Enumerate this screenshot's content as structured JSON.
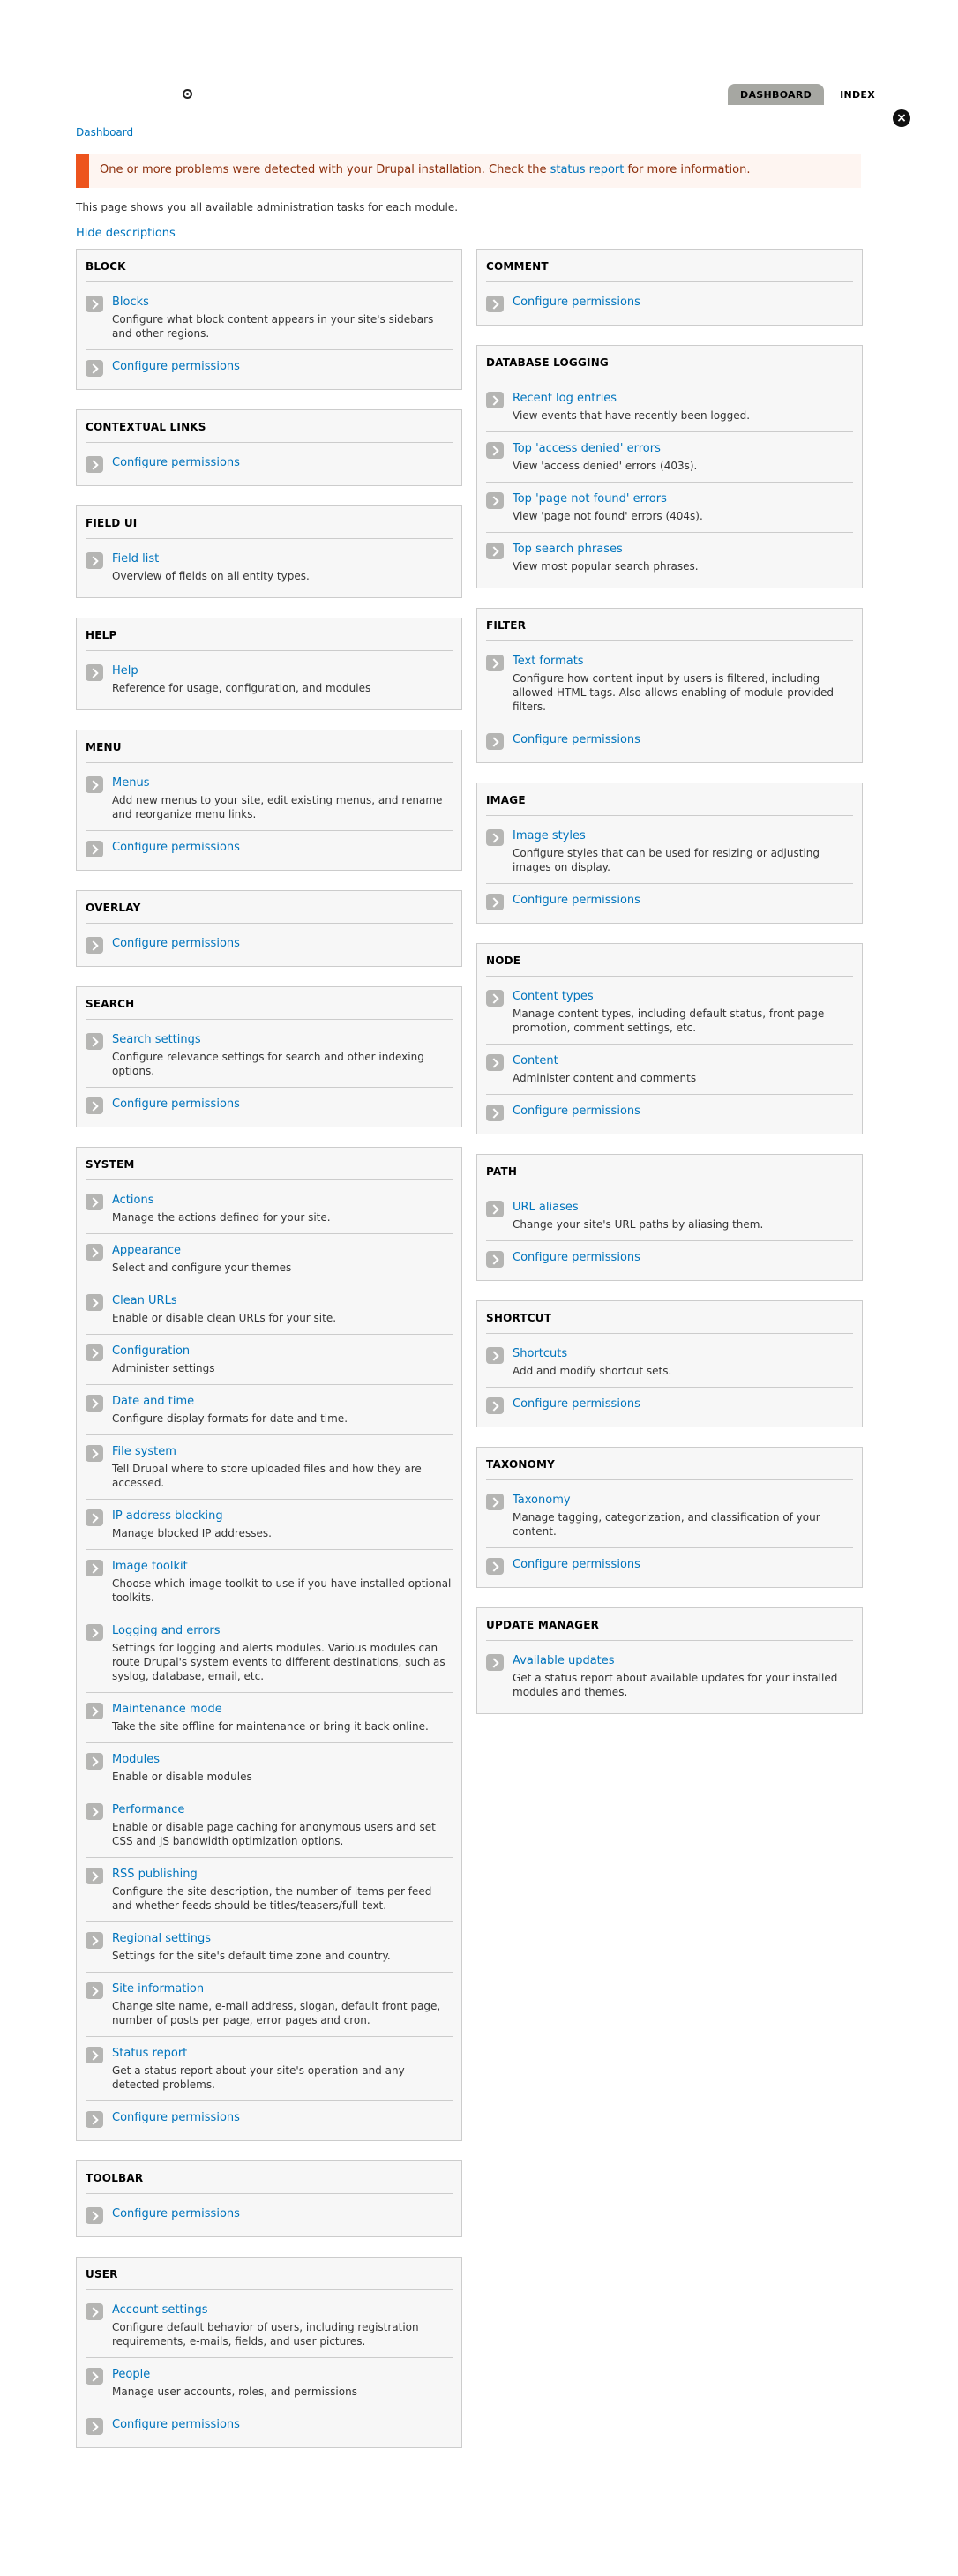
{
  "header": {
    "tabs": [
      {
        "label": "DASHBOARD",
        "active": true
      },
      {
        "label": "INDEX",
        "active": false
      }
    ],
    "close_symbol": "×"
  },
  "breadcrumb": "Dashboard",
  "message": {
    "prefix": "One or more problems were detected with your Drupal installation. Check the ",
    "link": "status report",
    "suffix": " for more information."
  },
  "intro": "This page shows you all available administration tasks for each module.",
  "hide_descriptions": "Hide descriptions",
  "left_panels": [
    {
      "title": "BLOCK",
      "items": [
        {
          "title": "Blocks",
          "desc": "Configure what block content appears in your site's sidebars and other regions."
        },
        {
          "title": "Configure permissions",
          "desc": ""
        }
      ]
    },
    {
      "title": "CONTEXTUAL LINKS",
      "items": [
        {
          "title": "Configure permissions",
          "desc": ""
        }
      ]
    },
    {
      "title": "FIELD UI",
      "items": [
        {
          "title": "Field list",
          "desc": "Overview of fields on all entity types."
        }
      ]
    },
    {
      "title": "HELP",
      "items": [
        {
          "title": "Help",
          "desc": "Reference for usage, configuration, and modules"
        }
      ]
    },
    {
      "title": "MENU",
      "items": [
        {
          "title": "Menus",
          "desc": "Add new menus to your site, edit existing menus, and rename and reorganize menu links."
        },
        {
          "title": "Configure permissions",
          "desc": ""
        }
      ]
    },
    {
      "title": "OVERLAY",
      "items": [
        {
          "title": "Configure permissions",
          "desc": ""
        }
      ]
    },
    {
      "title": "SEARCH",
      "items": [
        {
          "title": "Search settings",
          "desc": "Configure relevance settings for search and other indexing options."
        },
        {
          "title": "Configure permissions",
          "desc": ""
        }
      ]
    },
    {
      "title": "SYSTEM",
      "items": [
        {
          "title": "Actions",
          "desc": "Manage the actions defined for your site."
        },
        {
          "title": "Appearance",
          "desc": "Select and configure your themes"
        },
        {
          "title": "Clean URLs",
          "desc": "Enable or disable clean URLs for your site."
        },
        {
          "title": "Configuration",
          "desc": "Administer settings"
        },
        {
          "title": "Date and time",
          "desc": "Configure display formats for date and time."
        },
        {
          "title": "File system",
          "desc": "Tell Drupal where to store uploaded files and how they are accessed."
        },
        {
          "title": "IP address blocking",
          "desc": "Manage blocked IP addresses."
        },
        {
          "title": "Image toolkit",
          "desc": "Choose which image toolkit to use if you have installed optional toolkits."
        },
        {
          "title": "Logging and errors",
          "desc": "Settings for logging and alerts modules. Various modules can route Drupal's system events to different destinations, such as syslog, database, email, etc."
        },
        {
          "title": "Maintenance mode",
          "desc": "Take the site offline for maintenance or bring it back online."
        },
        {
          "title": "Modules",
          "desc": "Enable or disable modules"
        },
        {
          "title": "Performance",
          "desc": "Enable or disable page caching for anonymous users and set CSS and JS bandwidth optimization options."
        },
        {
          "title": "RSS publishing",
          "desc": "Configure the site description, the number of items per feed and whether feeds should be titles/teasers/full-text."
        },
        {
          "title": "Regional settings",
          "desc": "Settings for the site's default time zone and country."
        },
        {
          "title": "Site information",
          "desc": "Change site name, e-mail address, slogan, default front page, number of posts per page, error pages and cron."
        },
        {
          "title": "Status report",
          "desc": "Get a status report about your site's operation and any detected problems."
        },
        {
          "title": "Configure permissions",
          "desc": ""
        }
      ]
    },
    {
      "title": "TOOLBAR",
      "items": [
        {
          "title": "Configure permissions",
          "desc": ""
        }
      ]
    },
    {
      "title": "USER",
      "items": [
        {
          "title": "Account settings",
          "desc": "Configure default behavior of users, including registration requirements, e-mails, fields, and user pictures."
        },
        {
          "title": "People",
          "desc": "Manage user accounts, roles, and permissions"
        },
        {
          "title": "Configure permissions",
          "desc": ""
        }
      ]
    }
  ],
  "right_panels": [
    {
      "title": "COMMENT",
      "items": [
        {
          "title": "Configure permissions",
          "desc": ""
        }
      ]
    },
    {
      "title": "DATABASE LOGGING",
      "items": [
        {
          "title": "Recent log entries",
          "desc": "View events that have recently been logged."
        },
        {
          "title": "Top 'access denied' errors",
          "desc": "View 'access denied' errors (403s)."
        },
        {
          "title": "Top 'page not found' errors",
          "desc": "View 'page not found' errors (404s)."
        },
        {
          "title": "Top search phrases",
          "desc": "View most popular search phrases."
        }
      ]
    },
    {
      "title": "FILTER",
      "items": [
        {
          "title": "Text formats",
          "desc": "Configure how content input by users is filtered, including allowed HTML tags. Also allows enabling of module-provided filters."
        },
        {
          "title": "Configure permissions",
          "desc": ""
        }
      ]
    },
    {
      "title": "IMAGE",
      "items": [
        {
          "title": "Image styles",
          "desc": "Configure styles that can be used for resizing or adjusting images on display."
        },
        {
          "title": "Configure permissions",
          "desc": ""
        }
      ]
    },
    {
      "title": "NODE",
      "items": [
        {
          "title": "Content types",
          "desc": "Manage content types, including default status, front page promotion, comment settings, etc."
        },
        {
          "title": "Content",
          "desc": "Administer content and comments"
        },
        {
          "title": "Configure permissions",
          "desc": ""
        }
      ]
    },
    {
      "title": "PATH",
      "items": [
        {
          "title": "URL aliases",
          "desc": "Change your site's URL paths by aliasing them."
        },
        {
          "title": "Configure permissions",
          "desc": ""
        }
      ]
    },
    {
      "title": "SHORTCUT",
      "items": [
        {
          "title": "Shortcuts",
          "desc": "Add and modify shortcut sets."
        },
        {
          "title": "Configure permissions",
          "desc": ""
        }
      ]
    },
    {
      "title": "TAXONOMY",
      "items": [
        {
          "title": "Taxonomy",
          "desc": "Manage tagging, categorization, and classification of your content."
        },
        {
          "title": "Configure permissions",
          "desc": ""
        }
      ]
    },
    {
      "title": "UPDATE MANAGER",
      "items": [
        {
          "title": "Available updates",
          "desc": "Get a status report about available updates for your installed modules and themes."
        }
      ]
    }
  ]
}
